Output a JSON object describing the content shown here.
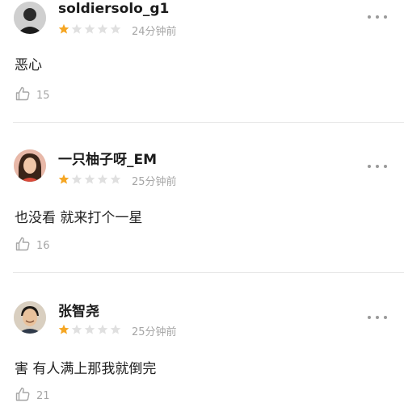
{
  "reviews": [
    {
      "username": "soldiersolo_g1",
      "rating": 1,
      "max_rating": 5,
      "time": "24分钟前",
      "text": "恶心",
      "likes": "15",
      "avatar": "user-avatar-man-dark"
    },
    {
      "username": "一只柚子呀_EM",
      "rating": 1,
      "max_rating": 5,
      "time": "25分钟前",
      "text": "也没看 就来打个一星",
      "likes": "16",
      "avatar": "user-avatar-woman"
    },
    {
      "username": "张智尧",
      "rating": 1,
      "max_rating": 5,
      "time": "25分钟前",
      "text": "害 有人满上那我就倒完",
      "likes": "21",
      "avatar": "user-avatar-man-smiling"
    }
  ],
  "colors": {
    "star_active": "#f5a623",
    "star_inactive": "#e0e0e0",
    "meta_text": "#a6a6a6",
    "divider": "#e7e7e7"
  },
  "icons": {
    "like": "thumb-up-icon",
    "more": "more-dots-icon",
    "star": "star-icon"
  }
}
